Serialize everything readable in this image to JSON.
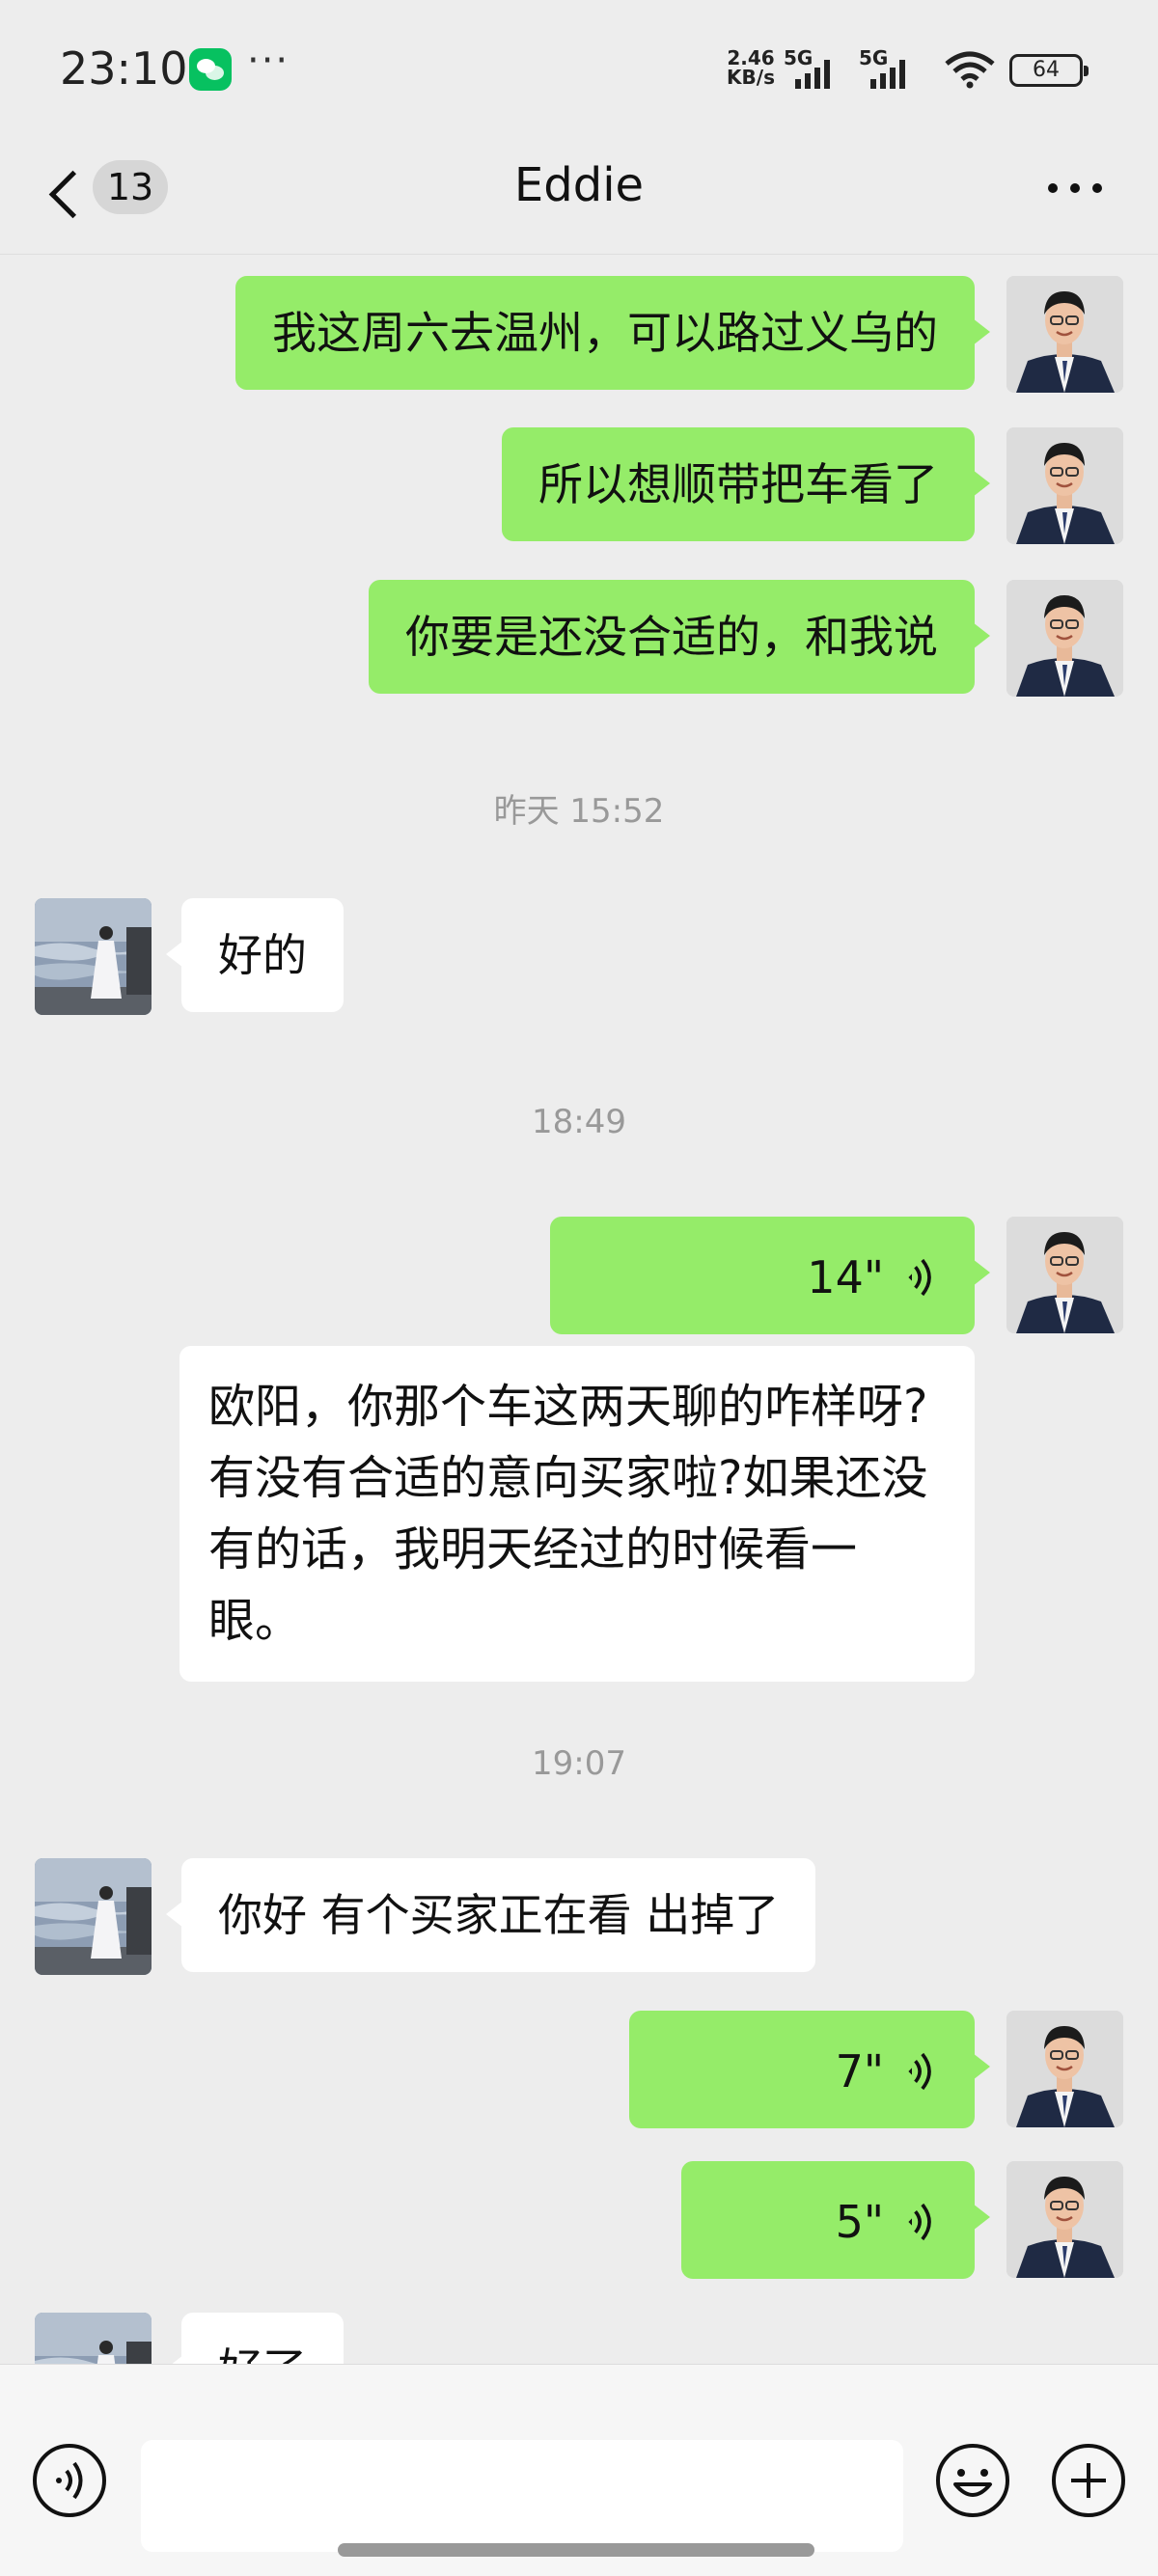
{
  "status_bar": {
    "time": "23:10",
    "more": "···",
    "net_speed_value": "2.46",
    "net_speed_unit": "KB/s",
    "sim1_label": "5G",
    "sim2_label": "5G",
    "battery": "64",
    "icons": [
      "wechat-icon",
      "signal-icon",
      "wifi-icon",
      "battery-icon"
    ]
  },
  "header": {
    "unread_count": "13",
    "title": "Eddie",
    "icons": [
      "back-icon",
      "more-icon"
    ]
  },
  "messages": [
    {
      "from": "me",
      "type": "text",
      "text": "我这周六去温州，可以路过义乌的"
    },
    {
      "from": "me",
      "type": "text",
      "text": "所以想顺带把车看了"
    },
    {
      "from": "me",
      "type": "text",
      "text": "你要是还没合适的，和我说"
    },
    {
      "type": "time",
      "text": "昨天 15:52"
    },
    {
      "from": "other",
      "type": "text",
      "text": "好的"
    },
    {
      "type": "time",
      "text": "18:49"
    },
    {
      "from": "me",
      "type": "voice",
      "duration": "14\""
    },
    {
      "type": "transcript",
      "text": "欧阳，你那个车这两天聊的咋样呀?有没有合适的意向买家啦?如果还没有的话，我明天经过的时候看一眼。"
    },
    {
      "type": "time",
      "text": "19:07"
    },
    {
      "from": "other",
      "type": "text",
      "text": "你好 有个买家正在看 出掉了"
    },
    {
      "from": "me",
      "type": "voice",
      "duration": "7\""
    },
    {
      "from": "me",
      "type": "voice",
      "duration": "5\""
    },
    {
      "from": "other",
      "type": "text",
      "text": "好了"
    }
  ],
  "input_bar": {
    "icons": [
      "voice-input-icon",
      "emoji-icon",
      "plus-icon"
    ]
  },
  "colors": {
    "background": "#ededed",
    "my_bubble": "#95ec69",
    "other_bubble": "#ffffff",
    "timestamp": "#999999",
    "wechat_green": "#07c160"
  }
}
